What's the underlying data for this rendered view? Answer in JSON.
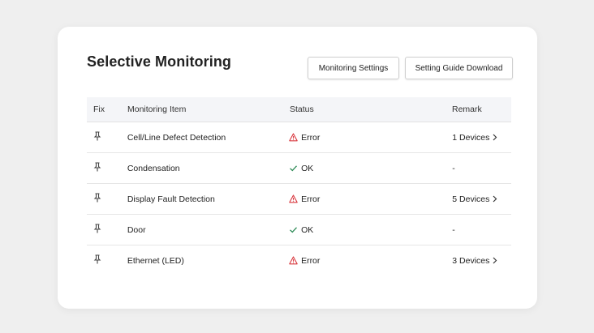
{
  "page": {
    "title": "Selective Monitoring",
    "buttons": {
      "monitoring_settings": "Monitoring Settings",
      "setting_guide_download": "Setting Guide Download"
    }
  },
  "table": {
    "headers": {
      "fix": "Fix",
      "item": "Monitoring Item",
      "status": "Status",
      "remark": "Remark"
    },
    "rows": [
      {
        "item": "Cell/Line Defect Detection",
        "status": "Error",
        "status_icon": "warning-icon",
        "remark": "1 Devices",
        "remark_link": true
      },
      {
        "item": "Condensation",
        "status": "OK",
        "status_icon": "check-icon",
        "remark": "-",
        "remark_link": false
      },
      {
        "item": "Display Fault Detection",
        "status": "Error",
        "status_icon": "warning-icon",
        "remark": "5 Devices",
        "remark_link": true
      },
      {
        "item": "Door",
        "status": "OK",
        "status_icon": "check-icon",
        "remark": "-",
        "remark_link": false
      },
      {
        "item": "Ethernet (LED)",
        "status": "Error",
        "status_icon": "warning-icon",
        "remark": "3 Devices",
        "remark_link": true
      }
    ]
  },
  "colors": {
    "error": "#d9383f",
    "ok": "#2e8b57",
    "background": "#efefef",
    "header_bg": "#f4f5f8"
  }
}
